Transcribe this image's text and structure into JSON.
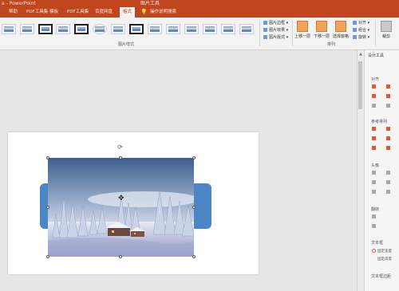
{
  "titlebar": {
    "title": "a - PowerPoint",
    "context_label": "图片工具"
  },
  "tabs": {
    "items": [
      {
        "label": "帮助"
      },
      {
        "label": "PDF工具集"
      },
      {
        "label": "模板"
      },
      {
        "label": "PDF工具集"
      },
      {
        "label": "百度网盘"
      },
      {
        "label": "格式",
        "active": true
      },
      {
        "label": "💡"
      },
      {
        "label": "操作说明搜索"
      }
    ]
  },
  "ribbon": {
    "group_picture_styles": "图片样式",
    "group_arrange": "排列",
    "picture_border": "图片边框 ▾",
    "picture_effects": "图片效果 ▾",
    "picture_layout": "图片版式 ▾",
    "bring_forward": "上移一层",
    "send_backward": "下移一层",
    "selection_pane": "选择窗格",
    "align": "对齐 ▾",
    "group": "组合 ▾",
    "rotate": "旋转 ▾",
    "crop": "裁剪"
  },
  "pane": {
    "title": "设计工具",
    "sec_align": "对齐",
    "sec_spacing": "参考排列",
    "sec_size": "头像",
    "sec_rotate": "翻转",
    "sec_text_box": "文本框",
    "opt_1": "固定宽度",
    "opt_2": "固定高度",
    "sec_text_margin": "文本框边距"
  },
  "colors": {
    "accent": "#c0461f",
    "shape_fill": "#4d86c5"
  },
  "icons": {
    "rotate_handle": "rotate-icon",
    "cursor": "move-cursor-icon"
  }
}
